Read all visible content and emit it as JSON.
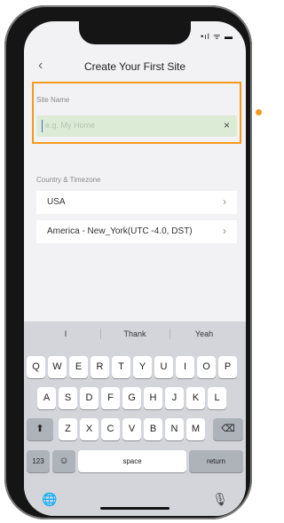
{
  "header": {
    "back_icon": "chevron-left-icon",
    "title": "Create Your First Site"
  },
  "site_name": {
    "label": "Site Name",
    "placeholder": "e.g. My Home",
    "clear_icon": "close-icon"
  },
  "country_timezone": {
    "label": "Country & Timezone",
    "country": "USA",
    "timezone": "America - New_York(UTC -4.0, DST)"
  },
  "keyboard": {
    "suggestions": [
      "I",
      "Thank",
      "Yeah"
    ],
    "row1": [
      "Q",
      "W",
      "E",
      "R",
      "T",
      "Y",
      "U",
      "I",
      "O",
      "P"
    ],
    "row2": [
      "A",
      "S",
      "D",
      "F",
      "G",
      "H",
      "J",
      "K",
      "L"
    ],
    "row3": [
      "Z",
      "X",
      "C",
      "V",
      "B",
      "N",
      "M"
    ],
    "shift_glyph": "⬆",
    "backspace_glyph": "⌫",
    "numbers_label": "123",
    "emoji_glyph": "☺",
    "space_label": "space",
    "return_label": "return",
    "globe_glyph": "🌐",
    "mic_glyph": "🎙"
  },
  "colors": {
    "highlight": "#f59a1f",
    "input_bg": "#dcebd6"
  }
}
